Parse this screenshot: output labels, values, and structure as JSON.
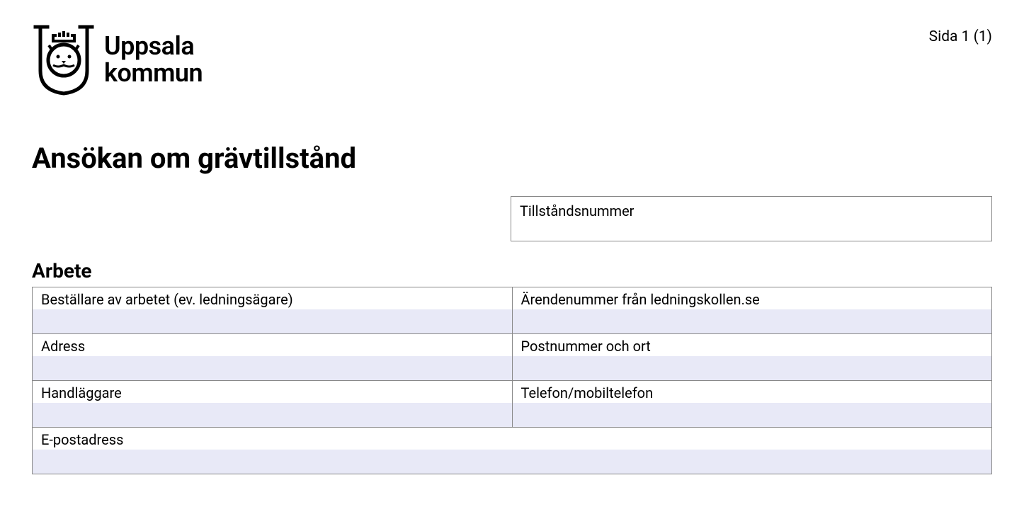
{
  "header": {
    "logo_line1": "Uppsala",
    "logo_line2": "kommun",
    "page_indicator": "Sida 1 (1)"
  },
  "title": "Ansökan om grävtillstånd",
  "permit_number_label": "Tillståndsnummer",
  "section_arbete": {
    "title": "Arbete",
    "fields": {
      "bestallare": "Beställare av arbetet (ev. ledningsägare)",
      "arendenummer": "Ärendenummer från ledningskollen.se",
      "adress": "Adress",
      "postnummer": "Postnummer och ort",
      "handlaggare": "Handläggare",
      "telefon": "Telefon/mobiltelefon",
      "epost": "E-postadress"
    }
  }
}
